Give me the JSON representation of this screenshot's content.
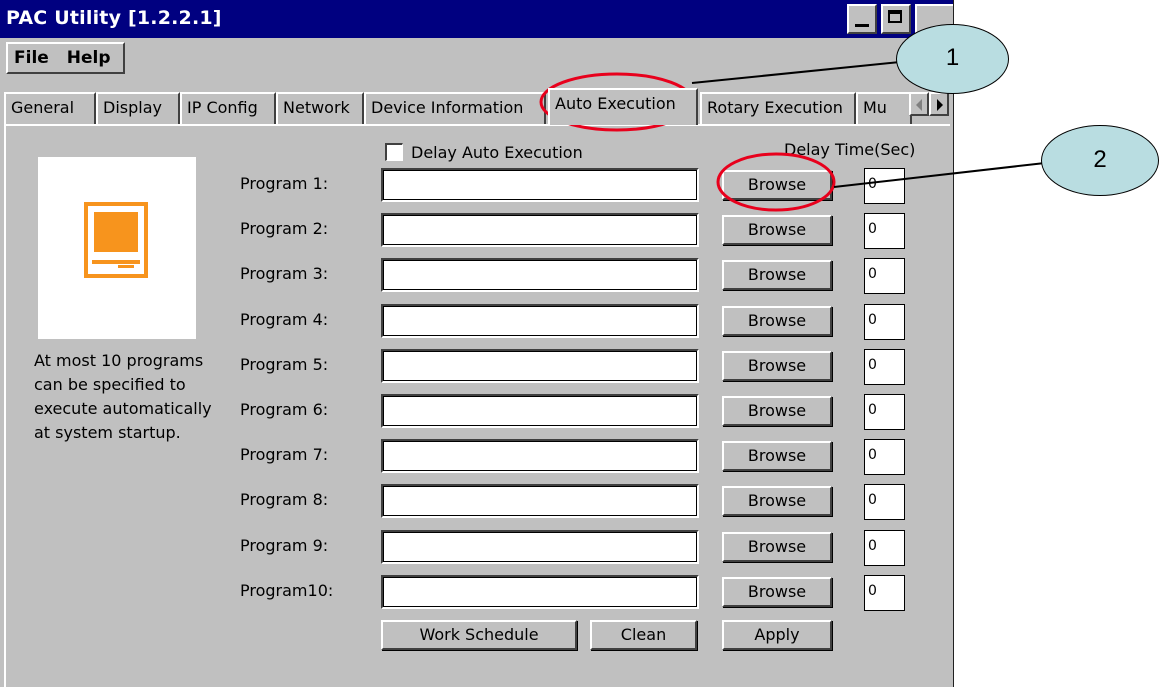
{
  "window": {
    "title": "PAC Utility  [1.2.2.1]"
  },
  "menu": {
    "items": [
      "File",
      "Help"
    ]
  },
  "tabs": [
    "General",
    "Display",
    "IP Config",
    "Network",
    "Device Information",
    "Auto Execution",
    "Rotary Execution",
    "Mu"
  ],
  "active_tab": "Auto Execution",
  "info_text": [
    "At most 10 programs",
    "can be specified to",
    "execute automatically",
    "at system startup."
  ],
  "delay_auto_execution": {
    "label": "Delay Auto Execution",
    "checked": false
  },
  "delay_time_header": "Delay Time(Sec)",
  "programs": [
    {
      "label": "Program 1:",
      "path": "",
      "browse": "Browse",
      "delay": "0"
    },
    {
      "label": "Program 2:",
      "path": "",
      "browse": "Browse",
      "delay": "0"
    },
    {
      "label": "Program 3:",
      "path": "",
      "browse": "Browse",
      "delay": "0"
    },
    {
      "label": "Program 4:",
      "path": "",
      "browse": "Browse",
      "delay": "0"
    },
    {
      "label": "Program 5:",
      "path": "",
      "browse": "Browse",
      "delay": "0"
    },
    {
      "label": "Program 6:",
      "path": "",
      "browse": "Browse",
      "delay": "0"
    },
    {
      "label": "Program 7:",
      "path": "",
      "browse": "Browse",
      "delay": "0"
    },
    {
      "label": "Program 8:",
      "path": "",
      "browse": "Browse",
      "delay": "0"
    },
    {
      "label": "Program 9:",
      "path": "",
      "browse": "Browse",
      "delay": "0"
    },
    {
      "label": "Program10:",
      "path": "",
      "browse": "Browse",
      "delay": "0"
    }
  ],
  "buttons": {
    "work_schedule": "Work Schedule",
    "clean": "Clean",
    "apply": "Apply"
  },
  "callouts": {
    "one": "1",
    "two": "2"
  },
  "colors": {
    "titlebar": "#000080",
    "face": "#c0c0c0",
    "icon": "#f7941d",
    "callout": "#b9dde1",
    "highlight": "#e8001c"
  },
  "icons": {
    "program_icon": "monitor-icon"
  }
}
